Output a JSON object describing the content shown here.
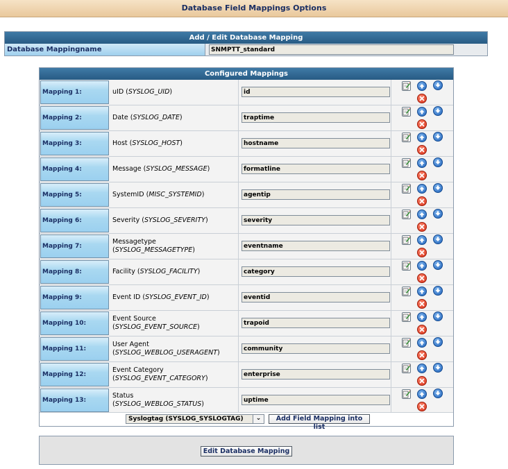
{
  "page": {
    "title": "Database Field Mappings Options"
  },
  "mapping_name": {
    "header": "Add / Edit Database Mapping",
    "label": "Database Mappingname",
    "value": "SNMPTT_standard"
  },
  "configured": {
    "header": "Configured Mappings",
    "rows": [
      {
        "label": "Mapping 1:",
        "field": "uID",
        "field2": "",
        "var": "SYSLOG_UID",
        "value": "id"
      },
      {
        "label": "Mapping 2:",
        "field": "Date",
        "field2": "",
        "var": "SYSLOG_DATE",
        "value": "traptime"
      },
      {
        "label": "Mapping 3:",
        "field": "Host",
        "field2": "",
        "var": "SYSLOG_HOST",
        "value": "hostname"
      },
      {
        "label": "Mapping 4:",
        "field": "Message",
        "field2": "",
        "var": "SYSLOG_MESSAGE",
        "value": "formatline"
      },
      {
        "label": "Mapping 5:",
        "field": "SystemID",
        "field2": "",
        "var": "MISC_SYSTEMID",
        "value": "agentip"
      },
      {
        "label": "Mapping 6:",
        "field": "Severity",
        "field2": "",
        "var": "SYSLOG_SEVERITY",
        "value": "severity"
      },
      {
        "label": "Mapping 7:",
        "field": "Messagetype",
        "field2": "break",
        "var": "SYSLOG_MESSAGETYPE",
        "value": "eventname"
      },
      {
        "label": "Mapping 8:",
        "field": "Facility",
        "field2": "",
        "var": "SYSLOG_FACILITY",
        "value": "category"
      },
      {
        "label": "Mapping 9:",
        "field": "Event ID",
        "field2": "",
        "var": "SYSLOG_EVENT_ID",
        "value": "eventid"
      },
      {
        "label": "Mapping 10:",
        "field": "Event Source",
        "field2": "break",
        "var": "SYSLOG_EVENT_SOURCE",
        "value": "trapoid"
      },
      {
        "label": "Mapping 11:",
        "field": "User Agent",
        "field2": "break",
        "var": "SYSLOG_WEBLOG_USERAGENT",
        "value": "community"
      },
      {
        "label": "Mapping 12:",
        "field": "Event Category",
        "field2": "break",
        "var": "SYSLOG_EVENT_CATEGORY",
        "value": "enterprise"
      },
      {
        "label": "Mapping 13:",
        "field": "Status",
        "field2": "break",
        "var": "SYSLOG_WEBLOG_STATUS",
        "value": "uptime"
      }
    ],
    "actions": {
      "edit_icon": "edit-icon",
      "up_icon": "arrow-up-icon",
      "down_icon": "arrow-down-icon",
      "delete_icon": "delete-icon"
    }
  },
  "add": {
    "select_value": "Syslogtag (SYSLOG_SYSLOGTAG)",
    "button": "Add Field Mapping into list"
  },
  "footer": {
    "button": "Edit Database Mapping"
  },
  "colors": {
    "header_blue": "#285b84",
    "label_blue": "#9fd0ee",
    "title_text": "#1a2e63"
  }
}
